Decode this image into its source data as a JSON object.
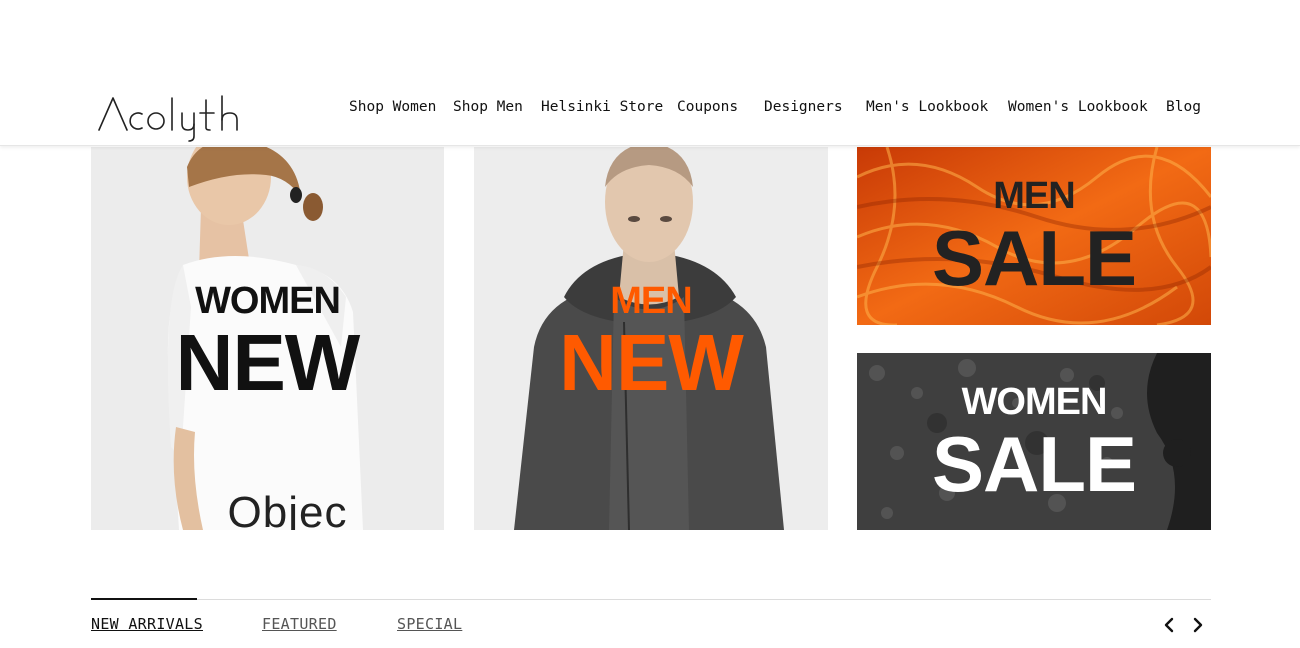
{
  "brand": {
    "logo_text": "Acolyth"
  },
  "nav": {
    "items": [
      "Shop Women",
      "Shop Men",
      "Helsinki Store",
      "Coupons",
      "Designers",
      "Men's Lookbook",
      "Women's Lookbook",
      "Blog"
    ]
  },
  "banners": {
    "women_new": {
      "line1": "WOMEN",
      "line2": "NEW",
      "shirt_print": "Objec"
    },
    "men_new": {
      "line1": "MEN",
      "line2": "NEW"
    },
    "men_sale": {
      "line1": "MEN",
      "line2": "SALE"
    },
    "women_sale": {
      "line1": "WOMEN",
      "line2": "SALE"
    }
  },
  "tabs": {
    "items": [
      "NEW ARRIVALS",
      "FEATURED",
      "SPECIAL"
    ],
    "active": "NEW ARRIVALS"
  },
  "carousel": {
    "prev_icon": "chevron-left-icon",
    "next_icon": "chevron-right-icon"
  },
  "colors": {
    "accent_orange": "#ff5a00",
    "text": "#111111"
  }
}
